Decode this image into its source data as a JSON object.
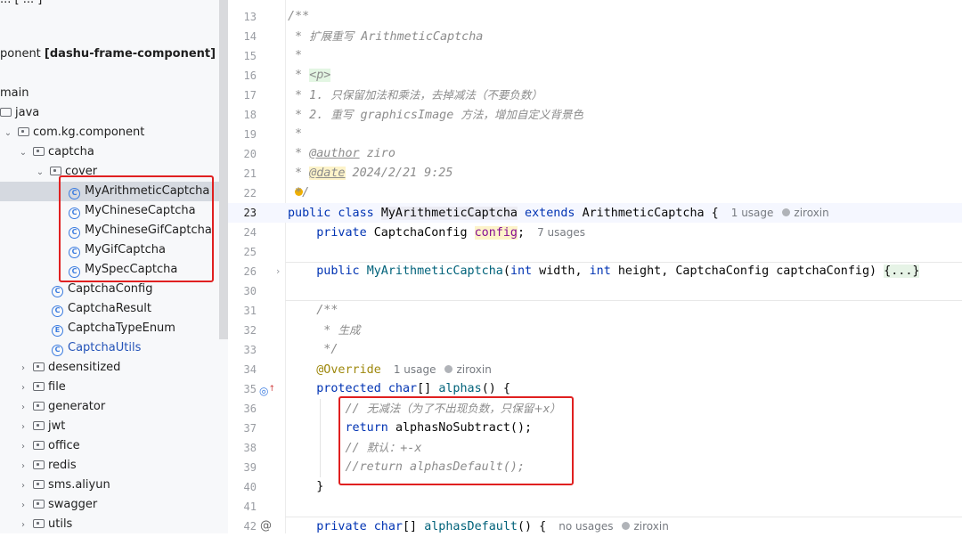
{
  "sidebar": {
    "items": [
      {
        "text": "ponent [dashu-frame-component]",
        "kind": "module"
      },
      {
        "text": "main",
        "kind": "folder"
      },
      {
        "text": "java",
        "kind": "folder"
      },
      {
        "text": "com.kg.component",
        "kind": "package"
      },
      {
        "text": "captcha",
        "kind": "package"
      },
      {
        "text": "cover",
        "kind": "package"
      },
      {
        "text": "MyArithmeticCaptcha",
        "kind": "class"
      },
      {
        "text": "MyChineseCaptcha",
        "kind": "class"
      },
      {
        "text": "MyChineseGifCaptcha",
        "kind": "class"
      },
      {
        "text": "MyGifCaptcha",
        "kind": "class"
      },
      {
        "text": "MySpecCaptcha",
        "kind": "class"
      },
      {
        "text": "CaptchaConfig",
        "kind": "class"
      },
      {
        "text": "CaptchaResult",
        "kind": "class"
      },
      {
        "text": "CaptchaTypeEnum",
        "kind": "enum"
      },
      {
        "text": "CaptchaUtils",
        "kind": "class"
      },
      {
        "text": "desensitized",
        "kind": "package"
      },
      {
        "text": "file",
        "kind": "package"
      },
      {
        "text": "generator",
        "kind": "package"
      },
      {
        "text": "jwt",
        "kind": "package"
      },
      {
        "text": "office",
        "kind": "package"
      },
      {
        "text": "redis",
        "kind": "package"
      },
      {
        "text": "sms.aliyun",
        "kind": "package"
      },
      {
        "text": "swagger",
        "kind": "package"
      },
      {
        "text": "utils",
        "kind": "package"
      }
    ],
    "module_name_prefix": "ponent ",
    "module_name_bracket": "[dashu-frame-component]"
  },
  "editor": {
    "line_numbers": [
      "13",
      "14",
      "15",
      "16",
      "17",
      "18",
      "19",
      "20",
      "21",
      "22",
      "23",
      "24",
      "25",
      "26",
      "30",
      "31",
      "32",
      "33",
      "34",
      "35",
      "36",
      "37",
      "38",
      "39",
      "40",
      "41",
      "42"
    ],
    "lines": {
      "l13": "/**",
      "l14_star": " * ",
      "l14_cn": "扩展重写",
      "l14_rest": " ArithmeticCaptcha",
      "l15": " *",
      "l16_star": " * ",
      "l16_tag": "<p>",
      "l17_star": " * 1. ",
      "l17_cn": "只保留加法和乘法，去掉减法（不要负数）",
      "l18_star": " * 2. ",
      "l18_cn1": "重写",
      "l18_mid": " graphicsImage ",
      "l18_cn2": "方法，增加自定义背景色",
      "l19": " *",
      "l20_star": " * ",
      "l20_tag": "@author",
      "l20_rest": " ziro",
      "l21_star": " * ",
      "l21_tag": "@date",
      "l21_rest": " 2024/2/21 9:25",
      "l22": " */",
      "l23_kw1": "public class ",
      "l23_name": "MyArithmeticCaptcha",
      "l23_kw2": " extends ",
      "l23_parent": "ArithmeticCaptcha {",
      "l23_usage": "1 usage",
      "l23_author": "ziroxin",
      "l24_kw": "    private ",
      "l24_type": "CaptchaConfig ",
      "l24_field": "config",
      "l24_end": ";",
      "l24_usage": "7 usages",
      "l26_kw": "    public ",
      "l26_name": "MyArithmeticCaptcha",
      "l26_p1": "(",
      "l26_int1": "int",
      "l26_p2": " width, ",
      "l26_int2": "int",
      "l26_p3": " height, CaptchaConfig captchaConfig) ",
      "l26_fold": "{...}",
      "l31": "    /**",
      "l32_star": "     * ",
      "l32_cn": "生成",
      "l33": "     */",
      "l34_anno": "    @Override",
      "l34_usage": "1 usage",
      "l34_author": "ziroxin",
      "l35_kw": "    protected ",
      "l35_type": "char",
      "l35_br": "[] ",
      "l35_name": "alphas",
      "l35_end": "() {",
      "l36_c": "        // ",
      "l36_cn": "无减法（为了不出现负数，只保留+x）",
      "l37_kw": "        return ",
      "l37_rest": "alphasNoSubtract();",
      "l38_c": "        // ",
      "l38_cn": "默认：",
      "l38_rest": "+-x",
      "l39": "        //return alphasDefault();",
      "l40": "    }",
      "l42_kw": "    private ",
      "l42_type": "char",
      "l42_br": "[] ",
      "l42_name": "alphasDefault",
      "l42_end": "() {",
      "l42_usage": "no usages",
      "l42_author": "ziroxin"
    }
  }
}
